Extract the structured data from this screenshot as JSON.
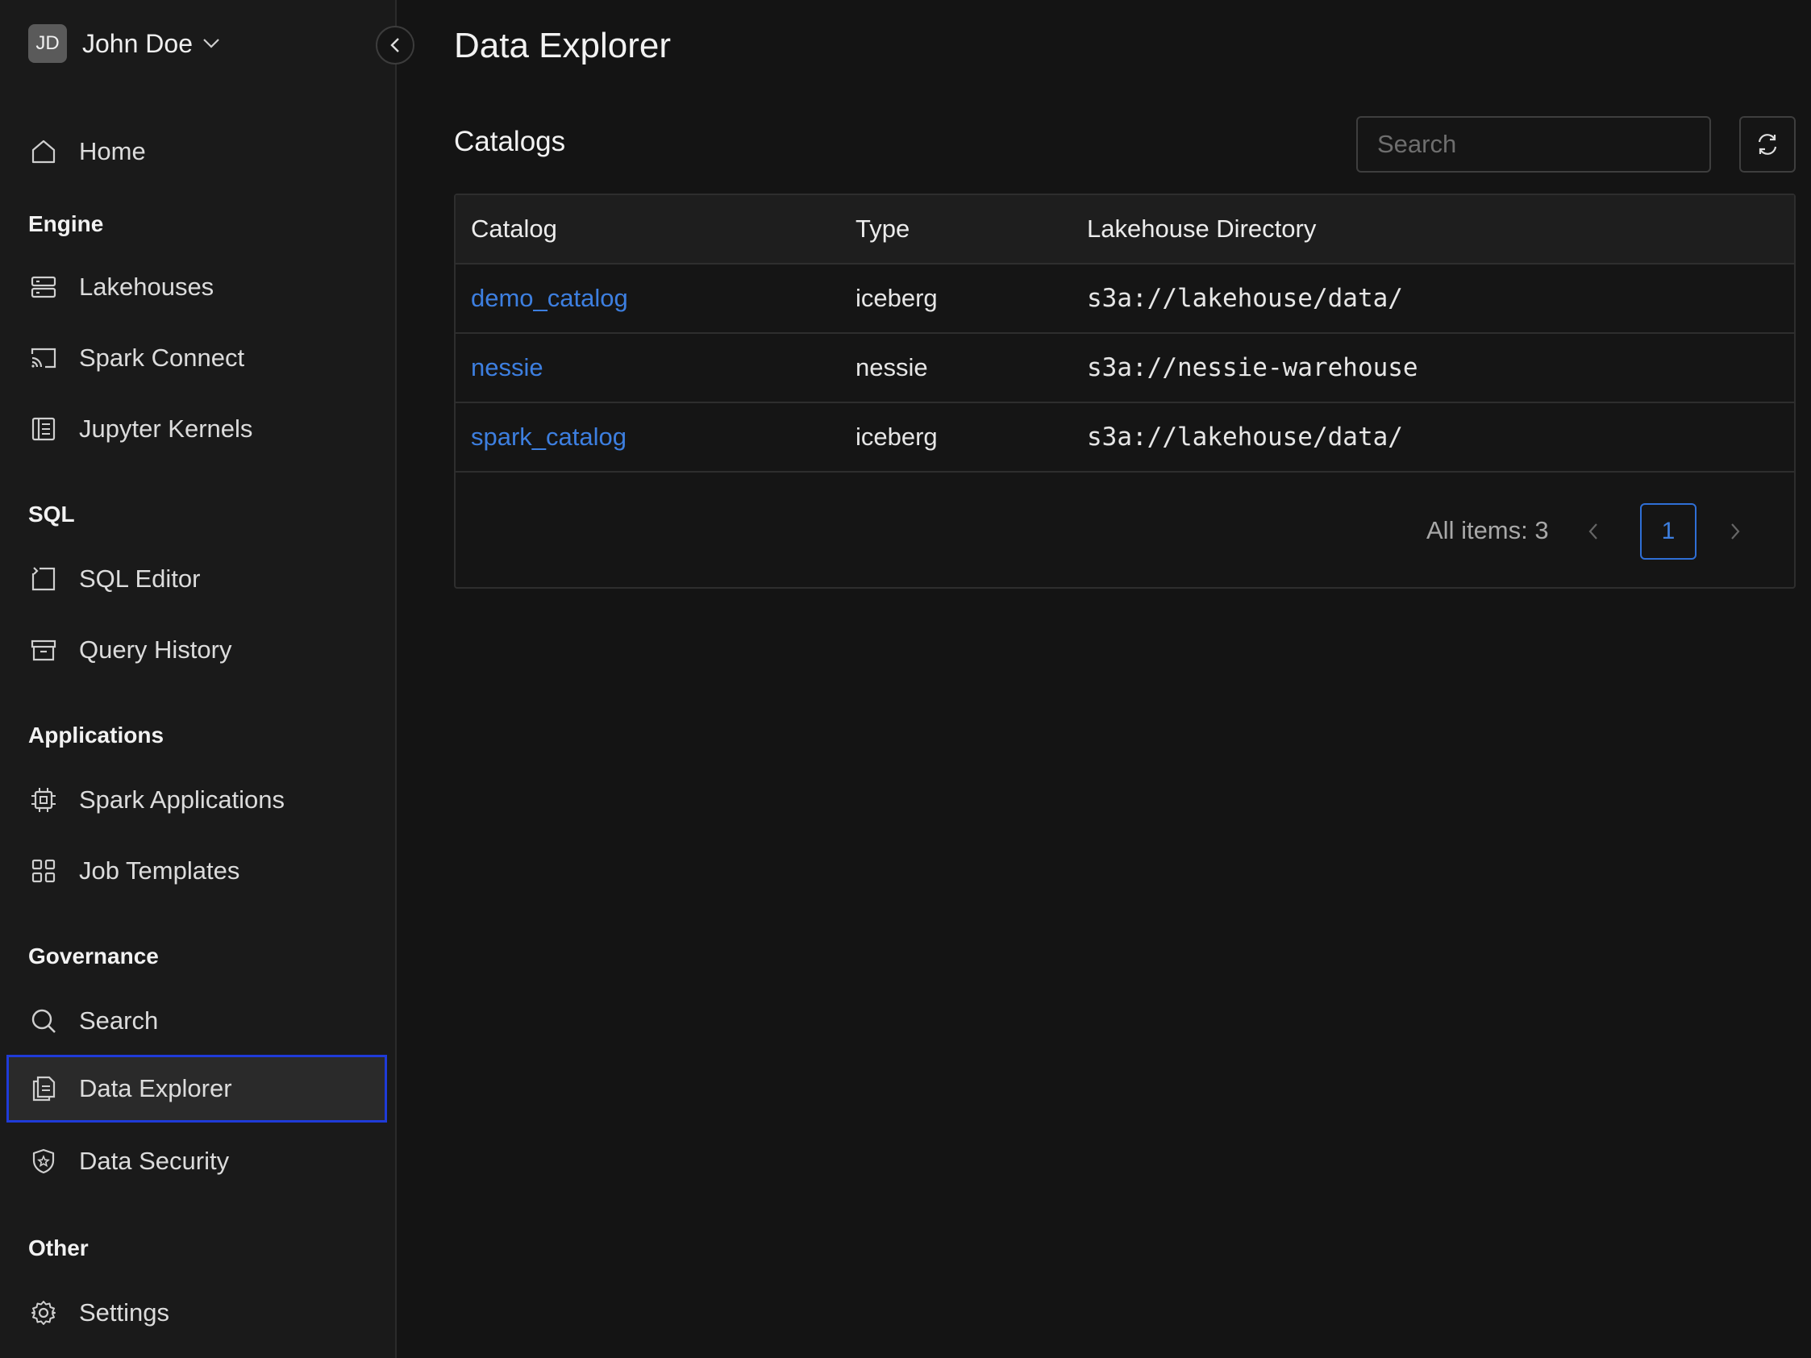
{
  "user": {
    "initials": "JD",
    "name": "John Doe"
  },
  "sidebar": {
    "home": "Home",
    "sections": {
      "engine": "Engine",
      "sql": "SQL",
      "applications": "Applications",
      "governance": "Governance",
      "other": "Other"
    },
    "items": {
      "lakehouses": "Lakehouses",
      "spark_connect": "Spark Connect",
      "jupyter_kernels": "Jupyter Kernels",
      "sql_editor": "SQL Editor",
      "query_history": "Query History",
      "spark_applications": "Spark Applications",
      "job_templates": "Job Templates",
      "search": "Search",
      "data_explorer": "Data Explorer",
      "data_security": "Data Security",
      "settings": "Settings"
    },
    "active_item": "data_explorer"
  },
  "main": {
    "title": "Data Explorer",
    "section_title": "Catalogs",
    "search_placeholder": "Search",
    "table": {
      "columns": [
        "Catalog",
        "Type",
        "Lakehouse Directory"
      ],
      "rows": [
        {
          "catalog": "demo_catalog",
          "type": "iceberg",
          "directory": "s3a://lakehouse/data/"
        },
        {
          "catalog": "nessie",
          "type": "nessie",
          "directory": "s3a://nessie-warehouse"
        },
        {
          "catalog": "spark_catalog",
          "type": "iceberg",
          "directory": "s3a://lakehouse/data/"
        }
      ]
    },
    "pagination": {
      "all_items": "All items: 3",
      "current_page": "1"
    }
  },
  "colors": {
    "background": "#141414",
    "sidebar": "#1a1a1a",
    "link": "#3d7fe0",
    "active_border": "#1f3bd8"
  }
}
